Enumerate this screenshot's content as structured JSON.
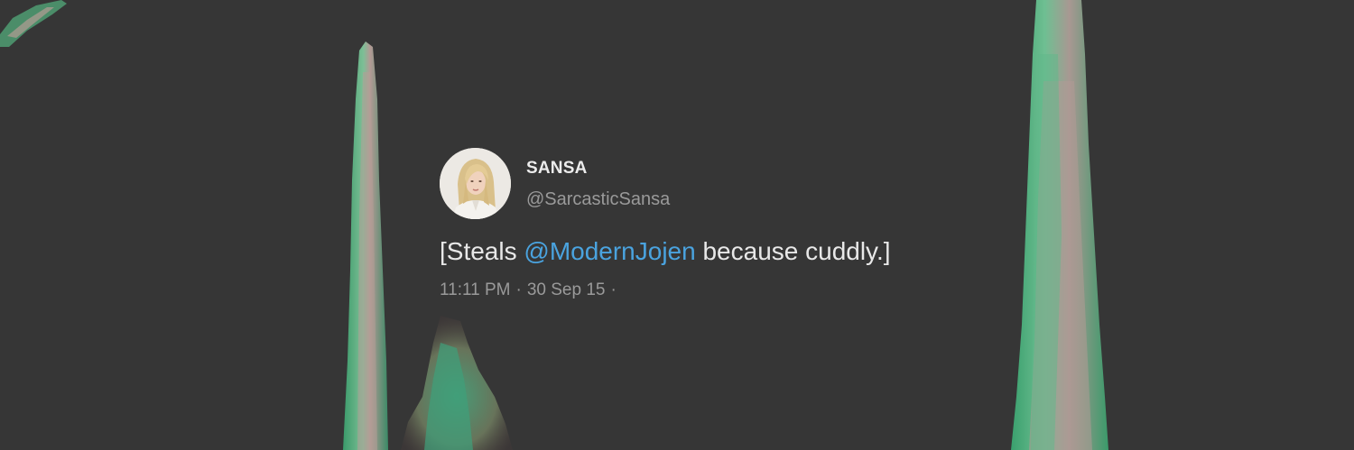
{
  "tweet": {
    "display_name": "SANSA",
    "handle": "@SarcasticSansa",
    "text_before": "[Steals ",
    "mention": "@ModernJojen",
    "text_after": " because cuddly.]",
    "time": "11:11 PM",
    "separator": "·",
    "date": "30 Sep 15",
    "trailing": "·"
  },
  "colors": {
    "background": "#363636",
    "mention": "#4aa3df",
    "muted_text": "#9a9a9a",
    "main_text": "#e8e8e8"
  }
}
